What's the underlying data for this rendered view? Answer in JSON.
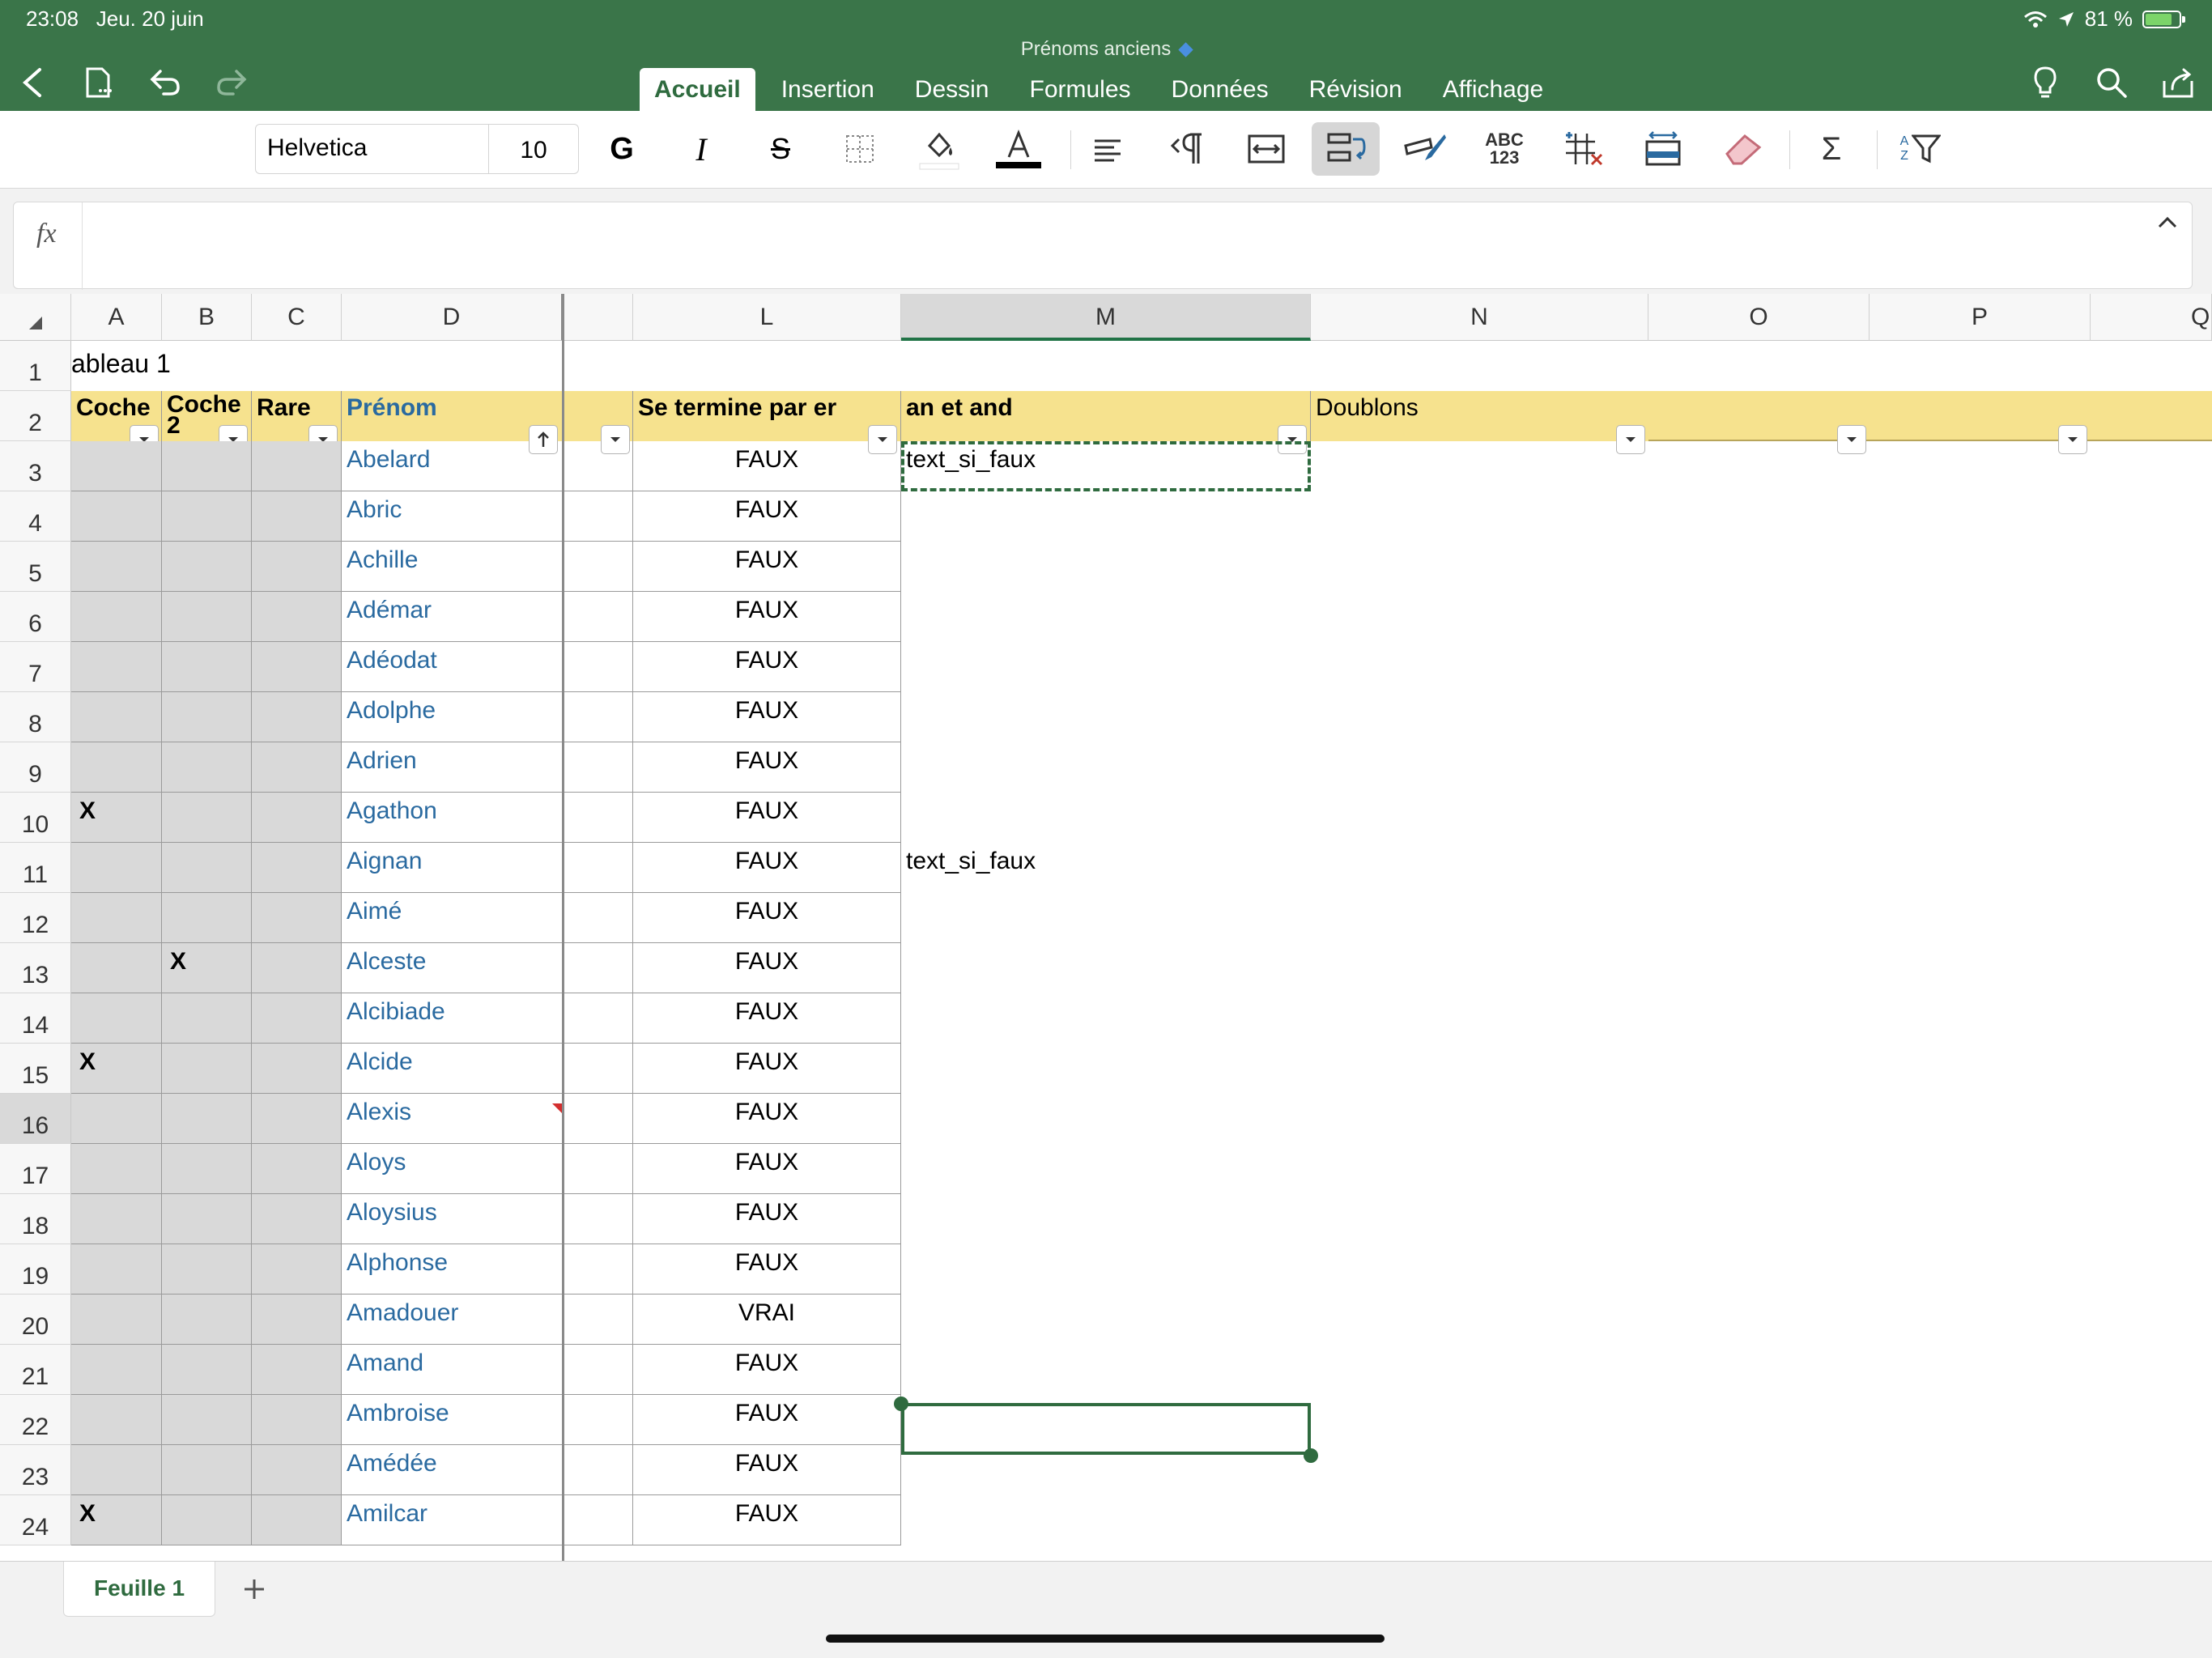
{
  "status": {
    "time": "23:08",
    "date": "Jeu. 20 juin",
    "battery": "81 %",
    "battery_level": 0.81
  },
  "document": {
    "title": "Prénoms anciens"
  },
  "tabs": [
    {
      "label": "Accueil",
      "active": true
    },
    {
      "label": "Insertion"
    },
    {
      "label": "Dessin"
    },
    {
      "label": "Formules"
    },
    {
      "label": "Données"
    },
    {
      "label": "Révision"
    },
    {
      "label": "Affichage"
    }
  ],
  "toolbar": {
    "font_name": "Helvetica",
    "font_size": "10",
    "bold_label": "G",
    "italic_label": "I",
    "strike_label": "S",
    "font_color": "#000000",
    "number_format_top": "ABC",
    "number_format_bottom": "123",
    "sum_label": "Σ",
    "sort_a": "A",
    "sort_z": "Z"
  },
  "formula_bar": {
    "fx_label": "fx",
    "content": ""
  },
  "columns": [
    "A",
    "B",
    "C",
    "D",
    "L",
    "M",
    "N",
    "O",
    "P",
    "Q"
  ],
  "selected_column": "M",
  "selected_row": 16,
  "sheet_title": "ableau 1",
  "table_headers": {
    "a": "Coche",
    "b": "Coche 2",
    "c": "Rare",
    "d": "Prénom",
    "l": "Se termine par er",
    "m": "an et and",
    "n": "Doublons"
  },
  "rows": [
    {
      "num": "3",
      "a": "",
      "b": "",
      "name": "Abelard",
      "l": "FAUX",
      "m": "text_si_faux"
    },
    {
      "num": "4",
      "a": "",
      "b": "",
      "name": "Abric",
      "l": "FAUX",
      "m": ""
    },
    {
      "num": "5",
      "a": "",
      "b": "",
      "name": "Achille",
      "l": "FAUX",
      "m": ""
    },
    {
      "num": "6",
      "a": "",
      "b": "",
      "name": "Adémar",
      "l": "FAUX",
      "m": ""
    },
    {
      "num": "7",
      "a": "",
      "b": "",
      "name": "Adéodat",
      "l": "FAUX",
      "m": ""
    },
    {
      "num": "8",
      "a": "",
      "b": "",
      "name": "Adolphe",
      "l": "FAUX",
      "m": ""
    },
    {
      "num": "9",
      "a": "",
      "b": "",
      "name": "Adrien",
      "l": "FAUX",
      "m": ""
    },
    {
      "num": "10",
      "a": "X",
      "b": "",
      "name": "Agathon",
      "l": "FAUX",
      "m": ""
    },
    {
      "num": "11",
      "a": "",
      "b": "",
      "name": "Aignan",
      "l": "FAUX",
      "m": "text_si_faux"
    },
    {
      "num": "12",
      "a": "",
      "b": "",
      "name": "Aimé",
      "l": "FAUX",
      "m": ""
    },
    {
      "num": "13",
      "a": "",
      "b": "X",
      "name": "Alceste",
      "l": "FAUX",
      "m": ""
    },
    {
      "num": "14",
      "a": "",
      "b": "",
      "name": "Alcibiade",
      "l": "FAUX",
      "m": ""
    },
    {
      "num": "15",
      "a": "X",
      "b": "",
      "name": "Alcide",
      "l": "FAUX",
      "m": ""
    },
    {
      "num": "16",
      "a": "",
      "b": "",
      "name": "Alexis",
      "l": "FAUX",
      "m": ""
    },
    {
      "num": "17",
      "a": "",
      "b": "",
      "name": "Aloys",
      "l": "FAUX",
      "m": ""
    },
    {
      "num": "18",
      "a": "",
      "b": "",
      "name": "Aloysius",
      "l": "FAUX",
      "m": ""
    },
    {
      "num": "19",
      "a": "",
      "b": "",
      "name": "Alphonse",
      "l": "FAUX",
      "m": ""
    },
    {
      "num": "20",
      "a": "",
      "b": "",
      "name": "Amadouer",
      "l": "VRAI",
      "m": ""
    },
    {
      "num": "21",
      "a": "",
      "b": "",
      "name": "Amand",
      "l": "FAUX",
      "m": ""
    },
    {
      "num": "22",
      "a": "",
      "b": "",
      "name": "Ambroise",
      "l": "FAUX",
      "m": ""
    },
    {
      "num": "23",
      "a": "",
      "b": "",
      "name": "Amédée",
      "l": "FAUX",
      "m": ""
    },
    {
      "num": "24",
      "a": "X",
      "b": "",
      "name": "Amilcar",
      "l": "FAUX",
      "m": ""
    }
  ],
  "sheets": [
    {
      "label": "Feuille 1",
      "active": true
    }
  ],
  "colors": {
    "header_green": "#3a7549",
    "table_header_yellow": "#f6e28e",
    "gray_cell": "#d9d9d9",
    "name_blue": "#2a6aa0",
    "selection_green": "#217346"
  }
}
